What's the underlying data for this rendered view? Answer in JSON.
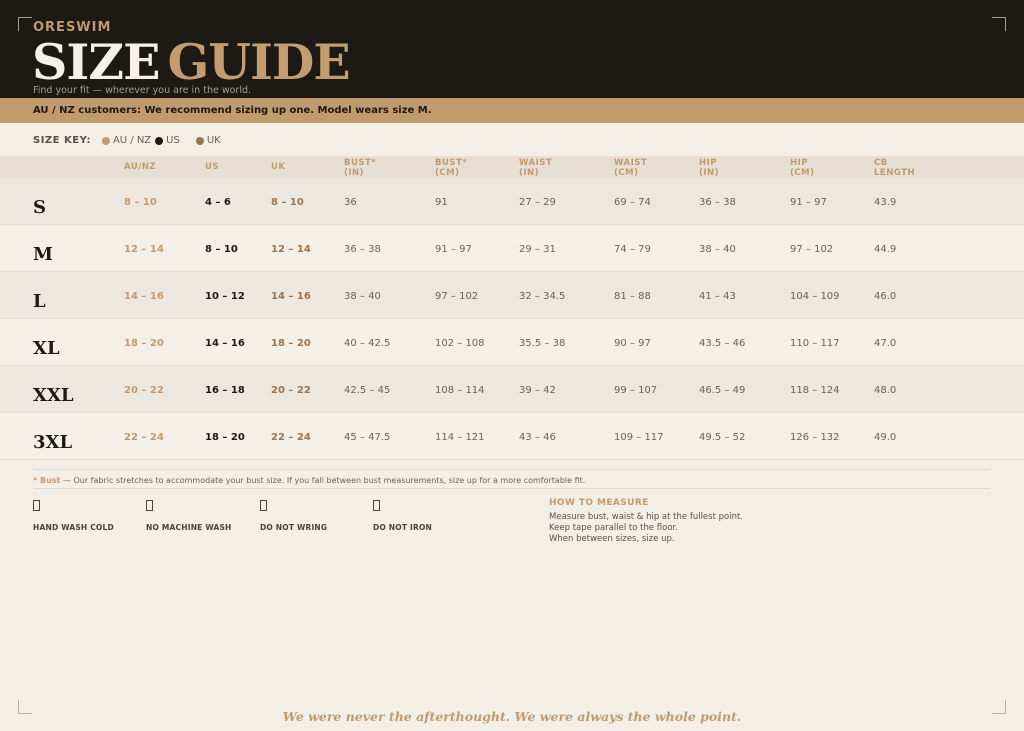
{
  "header": {
    "brand": "ORESWIM",
    "title_word1": "SIZE",
    "title_word2": "GUIDE",
    "tagline": "Find your fit — wherever you are in the world."
  },
  "band_text": "AU / NZ customers: We recommend sizing up one.  Model wears size M.",
  "size_key": {
    "label": "SIZE KEY:",
    "items": [
      {
        "label": "AU / NZ",
        "color": "#c19a6e"
      },
      {
        "label": "US",
        "color": "#1d1915"
      },
      {
        "label": "UK",
        "color": "#9a7550"
      }
    ]
  },
  "table": {
    "headers": [
      {
        "l1": "AU/NZ",
        "l2": ""
      },
      {
        "l1": "US",
        "l2": ""
      },
      {
        "l1": "UK",
        "l2": ""
      },
      {
        "l1": "BUST*",
        "l2": "(IN)"
      },
      {
        "l1": "BUST*",
        "l2": "(CM)"
      },
      {
        "l1": "WAIST",
        "l2": "(IN)"
      },
      {
        "l1": "WAIST",
        "l2": "(CM)"
      },
      {
        "l1": "HIP",
        "l2": "(IN)"
      },
      {
        "l1": "HIP",
        "l2": "(CM)"
      },
      {
        "l1": "CB",
        "l2": "LENGTH"
      }
    ],
    "rows": [
      {
        "size": "S",
        "au": "8 – 10",
        "us": "4 – 6",
        "uk": "8 – 10",
        "bust_in": "36",
        "bust_cm": "91",
        "waist_in": "27 – 29",
        "waist_cm": "69 – 74",
        "hip_in": "36 – 38",
        "hip_cm": "91 – 97",
        "cb": "43.9"
      },
      {
        "size": "M",
        "au": "12 – 14",
        "us": "8 – 10",
        "uk": "12 – 14",
        "bust_in": "36 – 38",
        "bust_cm": "91 – 97",
        "waist_in": "29 – 31",
        "waist_cm": "74 – 79",
        "hip_in": "38 – 40",
        "hip_cm": "97 – 102",
        "cb": "44.9"
      },
      {
        "size": "L",
        "au": "14 – 16",
        "us": "10 – 12",
        "uk": "14 – 16",
        "bust_in": "38 – 40",
        "bust_cm": "97 – 102",
        "waist_in": "32 – 34.5",
        "waist_cm": "81 – 88",
        "hip_in": "41 – 43",
        "hip_cm": "104 – 109",
        "cb": "46.0"
      },
      {
        "size": "XL",
        "au": "18 – 20",
        "us": "14 – 16",
        "uk": "18 – 20",
        "bust_in": "40 – 42.5",
        "bust_cm": "102 – 108",
        "waist_in": "35.5 – 38",
        "waist_cm": "90 – 97",
        "hip_in": "43.5 – 46",
        "hip_cm": "110 – 117",
        "cb": "47.0"
      },
      {
        "size": "XXL",
        "au": "20 – 22",
        "us": "16 – 18",
        "uk": "20 – 22",
        "bust_in": "42.5 – 45",
        "bust_cm": "108 – 114",
        "waist_in": "39 – 42",
        "waist_cm": "99 – 107",
        "hip_in": "46.5 – 49",
        "hip_cm": "118 – 124",
        "cb": "48.0"
      },
      {
        "size": "3XL",
        "au": "22 – 24",
        "us": "18 – 20",
        "uk": "22 – 24",
        "bust_in": "45 – 47.5",
        "bust_cm": "114 – 121",
        "waist_in": "43 – 46",
        "waist_cm": "109 – 117",
        "hip_in": "49.5 – 52",
        "hip_cm": "126 – 132",
        "cb": "49.0"
      }
    ]
  },
  "note": {
    "star": "* Bust",
    "text": " — Our fabric stretches to accommodate your bust size. If you fall between bust measurements, size up for a more comfortable fit."
  },
  "care": [
    {
      "label": "HAND WASH COLD",
      "icon": "hand-wash-icon"
    },
    {
      "label": "NO MACHINE WASH",
      "icon": "no-machine-wash-icon"
    },
    {
      "label": "DO NOT WRING",
      "icon": "do-not-wring-icon"
    },
    {
      "label": "DO NOT IRON",
      "icon": "do-not-iron-icon"
    }
  ],
  "how_to_measure": {
    "heading": "HOW TO MEASURE",
    "lines": [
      "Measure bust, waist & hip at the fullest point.",
      "Keep tape parallel to the floor.",
      "When between sizes, size up."
    ]
  },
  "footer": "We were never the afterthought. We were always the whole point."
}
